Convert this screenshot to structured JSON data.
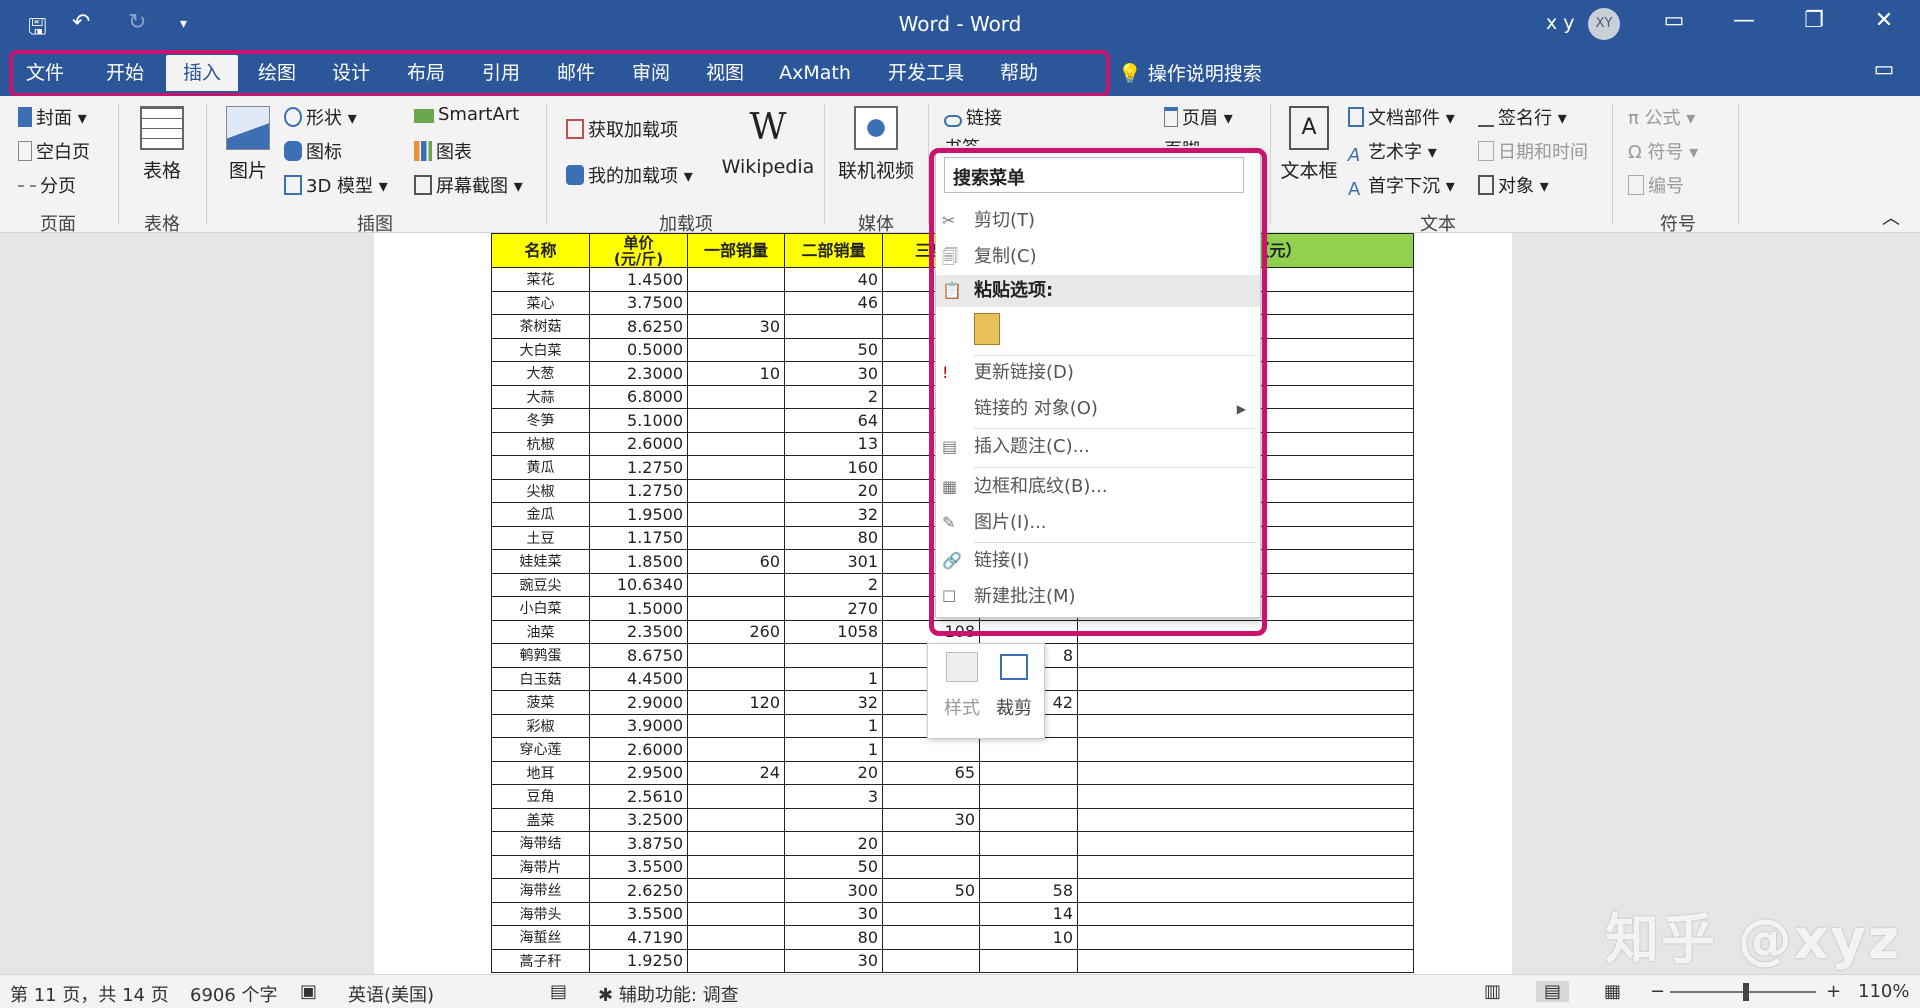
{
  "window": {
    "title": "Word - Word",
    "user_name": "x y",
    "avatar": "XY"
  },
  "tabs": [
    {
      "label": "文件"
    },
    {
      "label": "开始"
    },
    {
      "label": "插入"
    },
    {
      "label": "绘图"
    },
    {
      "label": "设计"
    },
    {
      "label": "布局"
    },
    {
      "label": "引用"
    },
    {
      "label": "邮件"
    },
    {
      "label": "审阅"
    },
    {
      "label": "视图"
    },
    {
      "label": "AxMath"
    },
    {
      "label": "开发工具"
    },
    {
      "label": "帮助"
    }
  ],
  "tell_me": "操作说明搜索",
  "ribbon": {
    "pages": {
      "cover": "封面",
      "blank": "空白页",
      "break": "分页",
      "group": "页面"
    },
    "table": {
      "table": "表格",
      "group": "表格"
    },
    "illus": {
      "picture": "图片",
      "shapes": "形状",
      "icons": "图标",
      "model3d": "3D 模型",
      "smartart": "SmartArt",
      "chart": "图表",
      "screenshot": "屏幕截图",
      "group": "插图"
    },
    "addins": {
      "get": "获取加载项",
      "mine": "我的加载项",
      "wiki": "Wikipedia",
      "group": "加载项"
    },
    "media": {
      "video": "联机视频",
      "group": "媒体"
    },
    "links": {
      "link": "链接",
      "bookmark": "书签"
    },
    "header": {
      "header": "页眉",
      "footer": "页脚"
    },
    "text": {
      "textbox": "文本框",
      "parts": "文档部件",
      "wordart": "艺术字",
      "dropcap": "首字下沉",
      "sig": "签名行",
      "datetime": "日期和时间",
      "object": "对象",
      "group": "文本"
    },
    "symbols": {
      "equation": "公式",
      "symbol": "符号",
      "number": "编号",
      "group": "符号"
    }
  },
  "table_headers": [
    "名称",
    "单价\n(元/斤)",
    "一部销量",
    "二部销量",
    "三部",
    "",
    "销售总额（元）"
  ],
  "table_rows": [
    [
      "菜花",
      "1.4500",
      "",
      "40",
      "",
      "",
      ""
    ],
    [
      "菜心",
      "3.7500",
      "",
      "46",
      "",
      "",
      ""
    ],
    [
      "茶树菇",
      "8.6250",
      "30",
      "",
      "",
      "",
      ""
    ],
    [
      "大白菜",
      "0.5000",
      "",
      "50",
      "",
      "",
      ""
    ],
    [
      "大葱",
      "2.3000",
      "10",
      "30",
      "",
      "",
      ""
    ],
    [
      "大蒜",
      "6.8000",
      "",
      "2",
      "",
      "",
      ""
    ],
    [
      "冬笋",
      "5.1000",
      "",
      "64",
      "",
      "",
      ""
    ],
    [
      "杭椒",
      "2.6000",
      "",
      "13",
      "",
      "",
      ""
    ],
    [
      "黄瓜",
      "1.2750",
      "",
      "160",
      "",
      "",
      ""
    ],
    [
      "尖椒",
      "1.2750",
      "",
      "20",
      "",
      "",
      ""
    ],
    [
      "金瓜",
      "1.9500",
      "",
      "32",
      "",
      "",
      ""
    ],
    [
      "土豆",
      "1.1750",
      "",
      "80",
      "",
      "",
      ""
    ],
    [
      "娃娃菜",
      "1.8500",
      "60",
      "301",
      "",
      "",
      ""
    ],
    [
      "豌豆尖",
      "10.6340",
      "",
      "2",
      "",
      "",
      ""
    ],
    [
      "小白菜",
      "1.5000",
      "",
      "270",
      "",
      "",
      ""
    ],
    [
      "油菜",
      "2.3500",
      "260",
      "1058",
      "108",
      "",
      ""
    ],
    [
      "鹌鹑蛋",
      "8.6750",
      "",
      "",
      "",
      "8",
      ""
    ],
    [
      "白玉菇",
      "4.4500",
      "",
      "1",
      "",
      "",
      ""
    ],
    [
      "菠菜",
      "2.9000",
      "120",
      "32",
      "",
      "42",
      ""
    ],
    [
      "彩椒",
      "3.9000",
      "",
      "1",
      "",
      "",
      ""
    ],
    [
      "穿心莲",
      "2.6000",
      "",
      "1",
      "",
      "",
      ""
    ],
    [
      "地耳",
      "2.9500",
      "24",
      "20",
      "65",
      "",
      ""
    ],
    [
      "豆角",
      "2.5610",
      "",
      "3",
      "",
      "",
      ""
    ],
    [
      "盖菜",
      "3.2500",
      "",
      "",
      "30",
      "",
      ""
    ],
    [
      "海带结",
      "3.8750",
      "",
      "20",
      "",
      "",
      ""
    ],
    [
      "海带片",
      "3.5500",
      "",
      "50",
      "",
      "",
      ""
    ],
    [
      "海带丝",
      "2.6250",
      "",
      "300",
      "50",
      "58",
      ""
    ],
    [
      "海带头",
      "3.5500",
      "",
      "30",
      "",
      "14",
      ""
    ],
    [
      "海蜇丝",
      "4.7190",
      "",
      "80",
      "",
      "10",
      ""
    ],
    [
      "蒿子秆",
      "1.9250",
      "",
      "30",
      "",
      "",
      ""
    ]
  ],
  "context_menu": {
    "search": "搜索菜单",
    "cut": "剪切(T)",
    "copy": "复制(C)",
    "paste_header": "粘贴选项:",
    "update_link": "更新链接(D)",
    "linked_object": "链接的 对象(O)",
    "caption": "插入题注(C)...",
    "borders": "边框和底纹(B)...",
    "picture": "图片(I)...",
    "link": "链接(I)",
    "comment": "新建批注(M)"
  },
  "mini_toolbar": {
    "style": "样式",
    "crop": "裁剪"
  },
  "status": {
    "page": "第 11 页，共 14 页",
    "words": "6906 个字",
    "lang": "英语(美国)",
    "access": "辅助功能: 调查",
    "zoom": "110%"
  },
  "watermark": "知乎 @xyz",
  "colors": {
    "titlebar": "#2b579a",
    "highlight": "#c8146c",
    "header_yellow": "#ffff00",
    "header_green": "#92d050"
  }
}
